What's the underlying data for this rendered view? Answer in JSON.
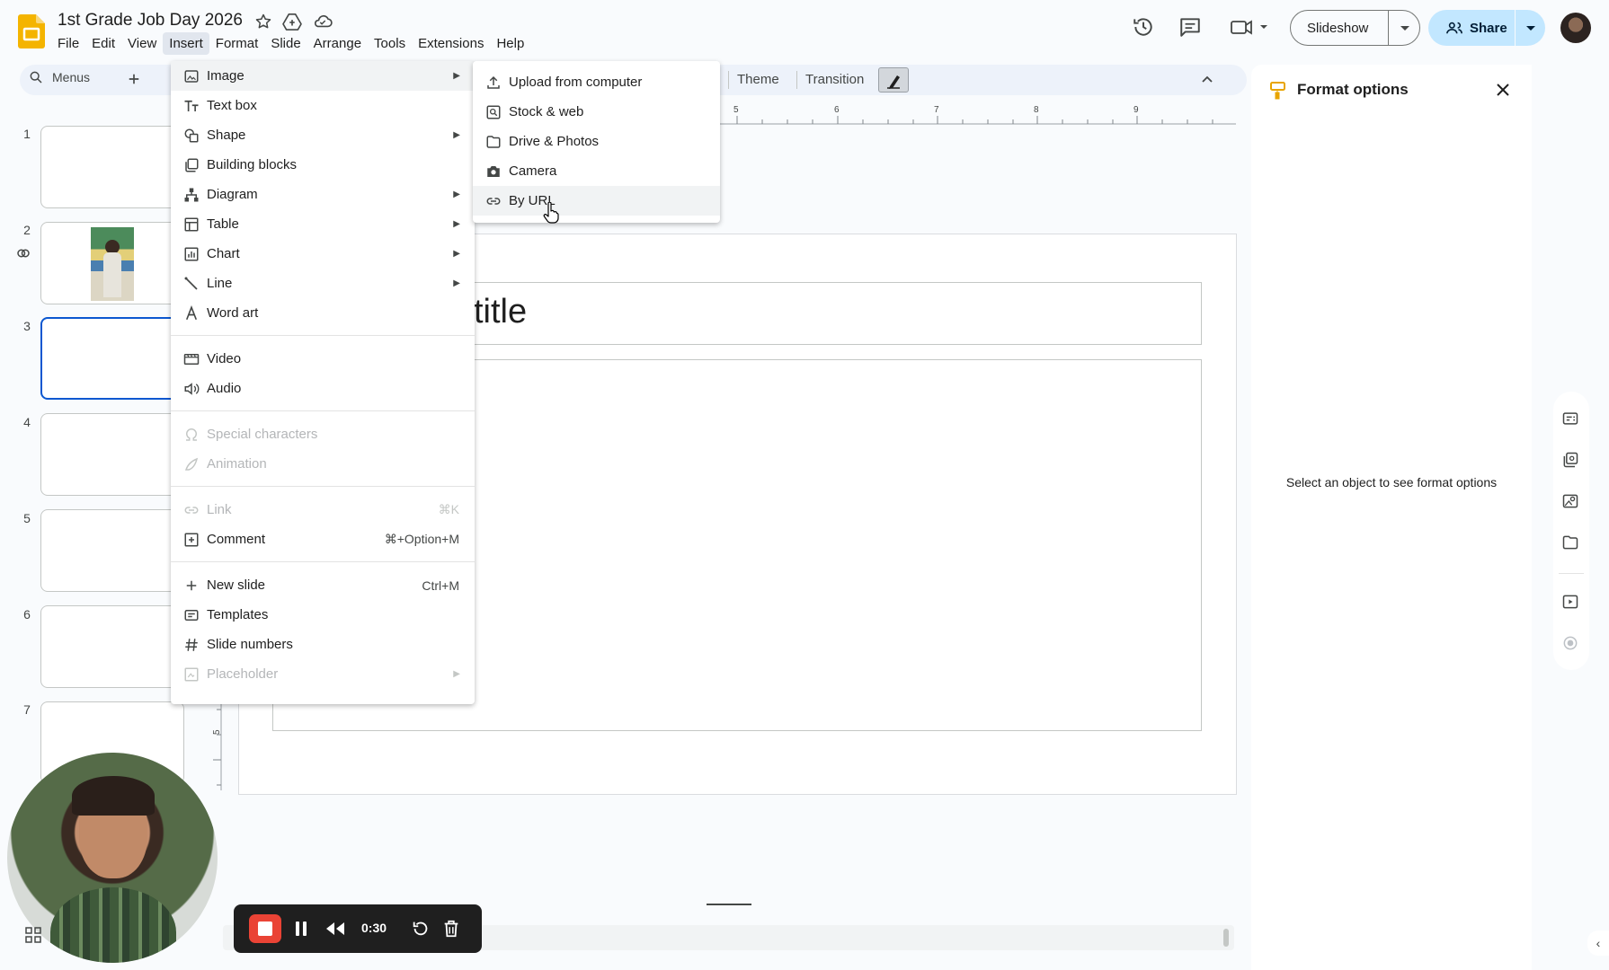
{
  "header": {
    "doc_title": "1st Grade Job Day 2026",
    "menus": [
      "File",
      "Edit",
      "View",
      "Insert",
      "Format",
      "Slide",
      "Arrange",
      "Tools",
      "Extensions",
      "Help"
    ],
    "active_menu": "Insert",
    "slideshow_label": "Slideshow",
    "share_label": "Share"
  },
  "toolbar": {
    "search_label": "Menus",
    "theme_label": "Theme",
    "transition_label": "Transition"
  },
  "filmstrip": {
    "slide_numbers": [
      "1",
      "2",
      "3",
      "4",
      "5",
      "6",
      "7"
    ],
    "selected_slide": "3"
  },
  "ruler": {
    "top_ticks": [
      "5",
      "6",
      "7",
      "8",
      "9"
    ],
    "left_tick": "5"
  },
  "canvas": {
    "title_text": "title"
  },
  "insert_menu": {
    "items": [
      {
        "label": "Image",
        "icon": "image-icon",
        "submenu": true,
        "state": "hover"
      },
      {
        "label": "Text box",
        "icon": "text-box-icon"
      },
      {
        "label": "Shape",
        "icon": "shape-icon",
        "submenu": true
      },
      {
        "label": "Building blocks",
        "icon": "building-blocks-icon"
      },
      {
        "label": "Diagram",
        "icon": "diagram-icon",
        "submenu": true
      },
      {
        "label": "Table",
        "icon": "table-icon",
        "submenu": true
      },
      {
        "label": "Chart",
        "icon": "chart-icon",
        "submenu": true
      },
      {
        "label": "Line",
        "icon": "line-icon",
        "submenu": true
      },
      {
        "label": "Word art",
        "icon": "word-art-icon"
      },
      {
        "label": "Video",
        "icon": "video-icon"
      },
      {
        "label": "Audio",
        "icon": "audio-icon"
      },
      {
        "label": "Special characters",
        "icon": "omega-icon",
        "disabled": true
      },
      {
        "label": "Animation",
        "icon": "animation-icon",
        "disabled": true
      },
      {
        "label": "Link",
        "icon": "link-icon",
        "shortcut": "⌘K",
        "disabled": true
      },
      {
        "label": "Comment",
        "icon": "comment-add-icon",
        "shortcut": "⌘+Option+M"
      },
      {
        "label": "New slide",
        "icon": "plus-icon",
        "shortcut": "Ctrl+M"
      },
      {
        "label": "Templates",
        "icon": "templates-icon"
      },
      {
        "label": "Slide numbers",
        "icon": "hash-icon"
      },
      {
        "label": "Placeholder",
        "icon": "placeholder-icon",
        "submenu": true,
        "disabled": true
      }
    ]
  },
  "image_submenu": {
    "items": [
      {
        "label": "Upload from computer",
        "icon": "upload-icon"
      },
      {
        "label": "Stock & web",
        "icon": "stock-search-icon"
      },
      {
        "label": "Drive & Photos",
        "icon": "folder-icon"
      },
      {
        "label": "Camera",
        "icon": "camera-icon"
      },
      {
        "label": "By URL",
        "icon": "link-icon",
        "state": "hover"
      }
    ]
  },
  "format_panel": {
    "title": "Format options",
    "empty_message": "Select an object to see format options"
  },
  "recorder": {
    "time": "0:30"
  },
  "colors": {
    "accent": "#0b57d0",
    "share_bg": "#c2e7ff",
    "record_red": "#ea4335",
    "app_yellow": "#f4b400"
  }
}
